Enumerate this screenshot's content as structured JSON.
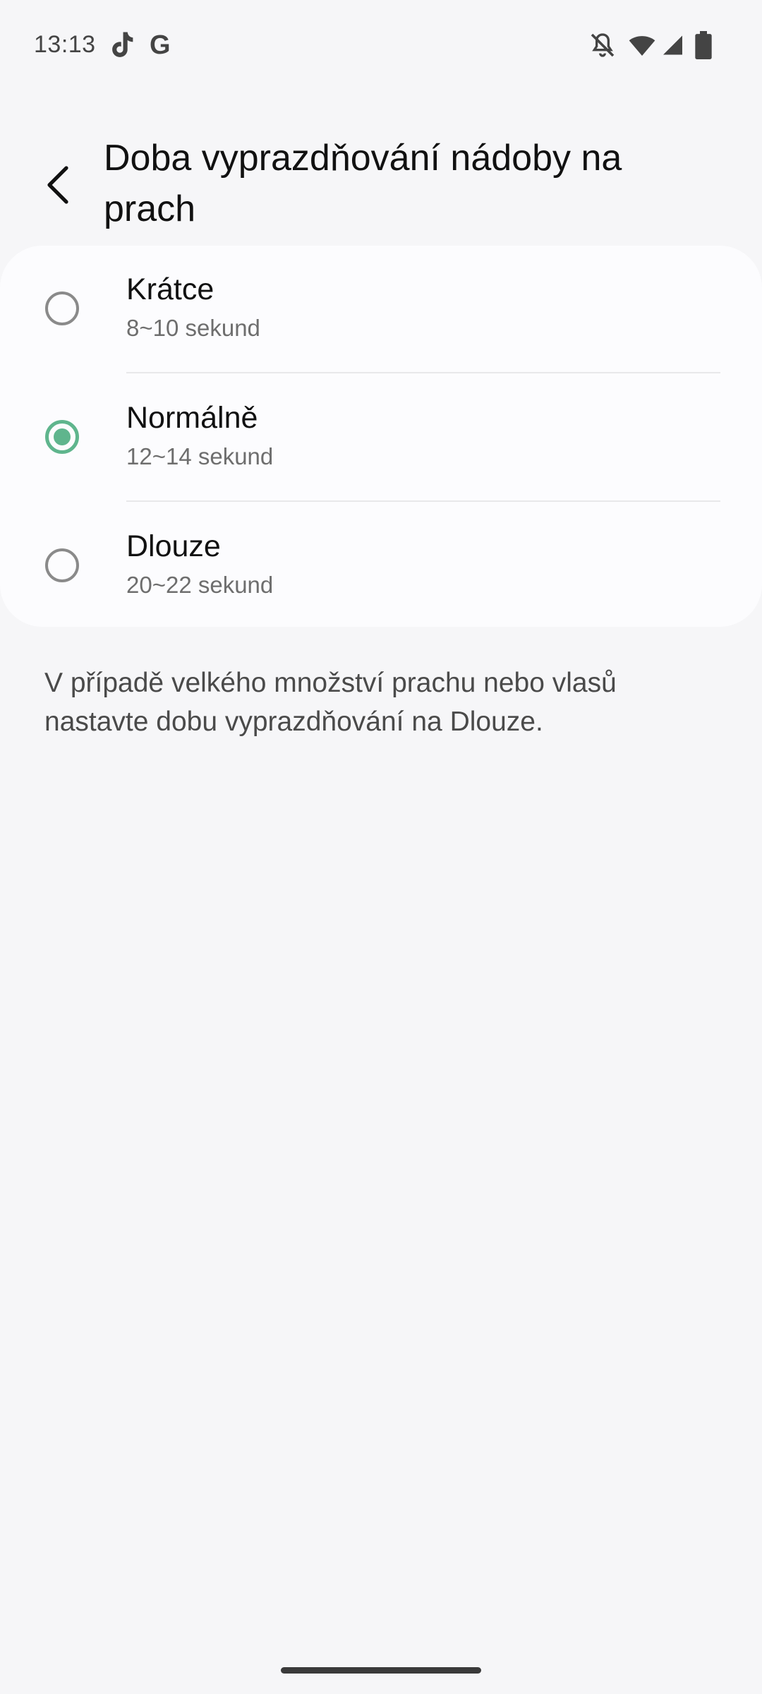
{
  "status_bar": {
    "time": "13:13",
    "google_letter": "G",
    "icons": [
      "tiktok-icon",
      "google-icon",
      "bell-off-icon",
      "wifi-icon",
      "signal-icon",
      "battery-icon"
    ]
  },
  "header": {
    "back_icon": "chevron-left-icon",
    "title": "Doba vyprazdňování nádoby na prach"
  },
  "options": [
    {
      "label": "Krátce",
      "sublabel": "8~10 sekund",
      "selected": false
    },
    {
      "label": "Normálně",
      "sublabel": "12~14 sekund",
      "selected": true
    },
    {
      "label": "Dlouze",
      "sublabel": "20~22 sekund",
      "selected": false
    }
  ],
  "info": {
    "text": "V případě velkého množství prachu nebo vlasů nastavte dobu vyprazdňování na Dlouze."
  },
  "colors": {
    "accent": "#5fb58d",
    "background": "#f6f6f8",
    "card": "#fcfcfe"
  }
}
